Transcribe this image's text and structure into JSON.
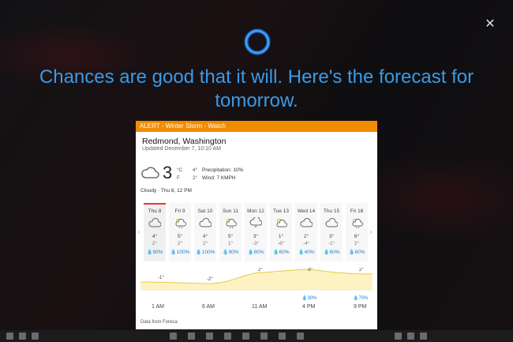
{
  "cortana": {
    "message": "Chances are good that it will. Here's the forecast for tomorrow.",
    "close_icon": "close-icon",
    "accent": "#3a9ae8"
  },
  "weather": {
    "alert": "ALERT - Winter Storm - Watch",
    "alert_color": "#f08c00",
    "location": "Redmond, Washington",
    "updated": "Updated December 7, 10:10 AM",
    "current": {
      "temp": "3",
      "unit_c": "°C",
      "unit_f": "F",
      "high": "4°",
      "low": "2°",
      "precipitation": "Precipitation: 10%",
      "wind": "Wind: 7 KMPH",
      "condition": "Cloudy · Thu 8, 12 PM",
      "icon": "cloudy-icon"
    },
    "days": [
      {
        "name": "Thu 8",
        "icon": "cloud-icon",
        "hi": "4°",
        "lo": "2°",
        "precip": "💧90%"
      },
      {
        "name": "Fri 9",
        "icon": "sun-rain-icon",
        "hi": "5°",
        "lo": "2°",
        "precip": "💧100%"
      },
      {
        "name": "Sat 10",
        "icon": "cloud-icon",
        "hi": "4°",
        "lo": "2°",
        "precip": "💧100%"
      },
      {
        "name": "Sun 11",
        "icon": "sun-rain-icon",
        "hi": "5°",
        "lo": "1°",
        "precip": "💧90%"
      },
      {
        "name": "Mon 12",
        "icon": "snow-icon",
        "hi": "3°",
        "lo": "-3°",
        "precip": "💧80%"
      },
      {
        "name": "Tue 13",
        "icon": "sun-cloud-icon",
        "hi": "1°",
        "lo": "-6°",
        "precip": "💧60%"
      },
      {
        "name": "Wed 14",
        "icon": "cloud-icon",
        "hi": "2°",
        "lo": "-4°",
        "precip": "💧40%"
      },
      {
        "name": "Thu 15",
        "icon": "cloud-icon",
        "hi": "3°",
        "lo": "-1°",
        "precip": "💧60%"
      },
      {
        "name": "Fri 16",
        "icon": "sun-rain-icon",
        "hi": "6°",
        "lo": "2°",
        "precip": "💧60%"
      }
    ],
    "hourly": {
      "labels": [
        "-1°",
        "-2°",
        "2°",
        "3°",
        "2°"
      ],
      "precip_labels": [
        "💧30%",
        "💧70%"
      ],
      "ticks": [
        "1 AM",
        "6 AM",
        "11 AM",
        "4 PM",
        "9 PM"
      ]
    },
    "source": "Data from Foreca"
  }
}
